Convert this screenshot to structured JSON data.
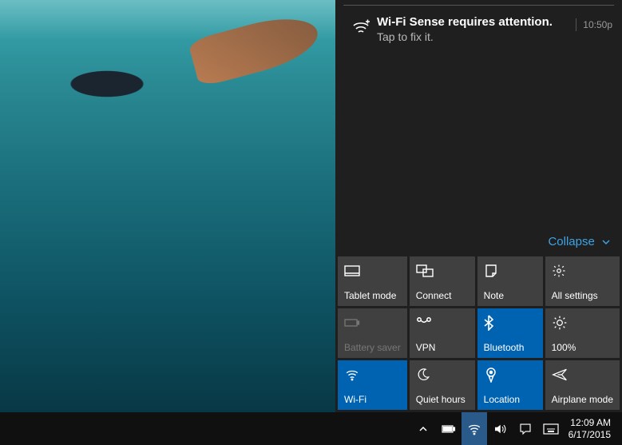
{
  "notification": {
    "title": "Wi-Fi Sense requires attention.",
    "subtitle": "Tap to fix it.",
    "time": "10:50p",
    "icon": "wifi-sense-icon"
  },
  "collapse_label": "Collapse",
  "quick_actions": [
    {
      "key": "tablet-mode",
      "label": "Tablet mode",
      "icon": "tablet-icon",
      "on": false,
      "disabled": false
    },
    {
      "key": "connect",
      "label": "Connect",
      "icon": "connect-icon",
      "on": false,
      "disabled": false
    },
    {
      "key": "note",
      "label": "Note",
      "icon": "note-icon",
      "on": false,
      "disabled": false
    },
    {
      "key": "all-settings",
      "label": "All settings",
      "icon": "gear-icon",
      "on": false,
      "disabled": false
    },
    {
      "key": "battery-saver",
      "label": "Battery saver",
      "icon": "battery-icon",
      "on": false,
      "disabled": true
    },
    {
      "key": "vpn",
      "label": "VPN",
      "icon": "vpn-icon",
      "on": false,
      "disabled": false
    },
    {
      "key": "bluetooth",
      "label": "Bluetooth",
      "icon": "bluetooth-icon",
      "on": true,
      "disabled": false
    },
    {
      "key": "brightness",
      "label": "100%",
      "icon": "sun-icon",
      "on": false,
      "disabled": false
    },
    {
      "key": "wifi",
      "label": "Wi-Fi",
      "icon": "wifi-icon",
      "on": true,
      "disabled": false
    },
    {
      "key": "quiet-hours",
      "label": "Quiet hours",
      "icon": "moon-icon",
      "on": false,
      "disabled": false
    },
    {
      "key": "location",
      "label": "Location",
      "icon": "location-icon",
      "on": true,
      "disabled": false
    },
    {
      "key": "airplane-mode",
      "label": "Airplane mode",
      "icon": "airplane-icon",
      "on": false,
      "disabled": false
    }
  ],
  "taskbar": {
    "time": "12:09 AM",
    "date": "6/17/2015"
  }
}
